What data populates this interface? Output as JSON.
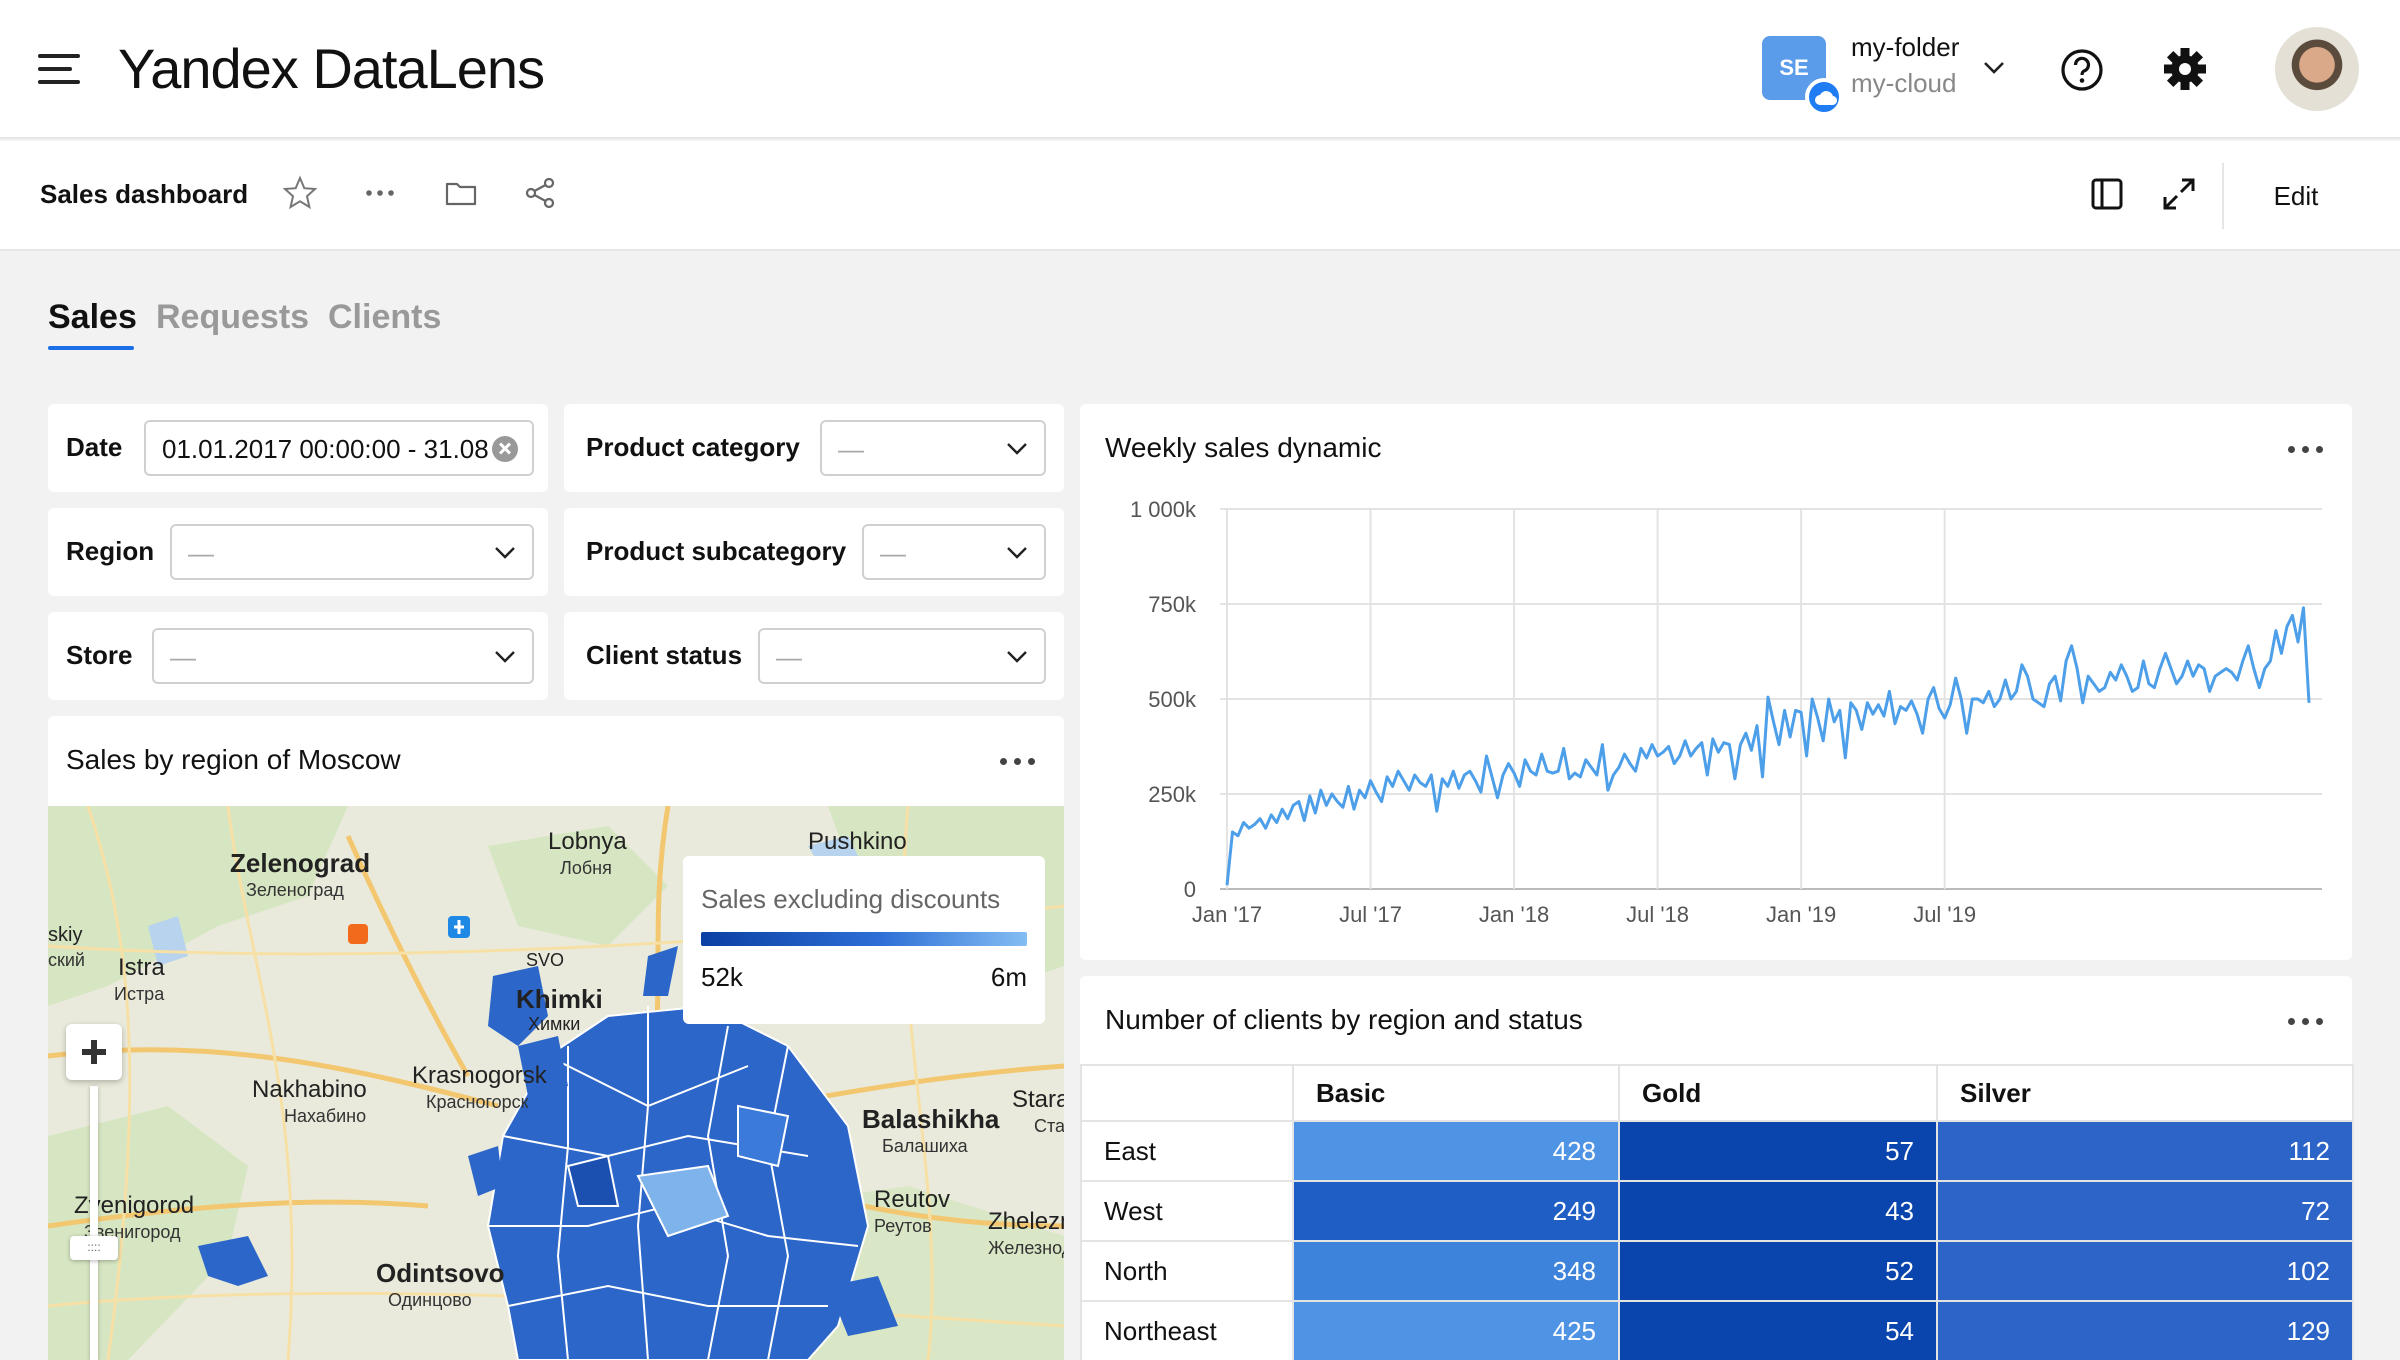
{
  "header": {
    "brand_bold": "Yandex",
    "brand_light": "DataLens",
    "folder_initials": "SE",
    "folder_name": "my-folder",
    "cloud_name": "my-cloud",
    "icons": [
      "menu-icon",
      "chevron-down-icon",
      "help-icon",
      "settings-gear-icon",
      "cloud-icon"
    ]
  },
  "toolbar": {
    "title": "Sales dashboard",
    "edit_label": "Edit",
    "icons": [
      "star-icon",
      "more-icon",
      "folder-icon",
      "share-icon",
      "sidebar-toggle-icon",
      "fullscreen-icon"
    ]
  },
  "tabs": [
    {
      "label": "Sales",
      "active": true
    },
    {
      "label": "Requests",
      "active": false
    },
    {
      "label": "Clients",
      "active": false
    }
  ],
  "selectors": {
    "date": {
      "label": "Date",
      "value": "01.01.2017 00:00:00 - 31.08"
    },
    "product_category": {
      "label": "Product category",
      "value": "—"
    },
    "region": {
      "label": "Region",
      "value": "—"
    },
    "product_subcategory": {
      "label": "Product subcategory",
      "value": "—"
    },
    "store": {
      "label": "Store",
      "value": "—"
    },
    "client_status": {
      "label": "Client status",
      "value": "—"
    }
  },
  "map_widget": {
    "title": "Sales by region of Moscow",
    "legend_title": "Sales excluding discounts",
    "legend_min": "52k",
    "legend_max": "6m",
    "place_labels": [
      {
        "name": "Zelenograd",
        "sub": "Зеленоград"
      },
      {
        "name": "Lobnya",
        "sub": "Лобня"
      },
      {
        "name": "Pushkino",
        "sub": ""
      },
      {
        "name": "Istra",
        "sub": "Истра"
      },
      {
        "name": "Khimki",
        "sub": "Химки"
      },
      {
        "name": "Nakhabino",
        "sub": "Нахабино"
      },
      {
        "name": "Krasnogorsk",
        "sub": "Красногорск"
      },
      {
        "name": "Balashikha",
        "sub": "Балашиха"
      },
      {
        "name": "Reutov",
        "sub": "Реутов"
      },
      {
        "name": "Zvenigorod",
        "sub": "Звенигород"
      },
      {
        "name": "Odintsovo",
        "sub": "Одинцово"
      },
      {
        "name": "Zheleznodorozhny",
        "sub": "Железнодорожный"
      },
      {
        "name": "SVO",
        "sub": ""
      },
      {
        "name": "Stara",
        "sub": "Ста"
      },
      {
        "name": "skiy",
        "sub": "ский"
      }
    ]
  },
  "line_widget": {
    "title": "Weekly sales dynamic"
  },
  "chart_data": {
    "type": "line",
    "title": "Weekly sales dynamic",
    "xlabel": "",
    "ylabel": "",
    "x_tick_labels": [
      "Jan '17",
      "Jul '17",
      "Jan '18",
      "Jul '18",
      "Jan '19",
      "Jul '19"
    ],
    "y_tick_labels": [
      "0",
      "250k",
      "500k",
      "750k",
      "1 000k"
    ],
    "ylim": [
      0,
      1000000
    ],
    "grid": true,
    "color": "#4c9fe8",
    "series": [
      {
        "values": [
          10000,
          150000,
          140000,
          175000,
          160000,
          170000,
          185000,
          160000,
          195000,
          175000,
          210000,
          185000,
          220000,
          230000,
          180000,
          245000,
          200000,
          260000,
          220000,
          250000,
          230000,
          215000,
          270000,
          210000,
          260000,
          240000,
          285000,
          255000,
          230000,
          295000,
          270000,
          310000,
          285000,
          260000,
          300000,
          280000,
          270000,
          300000,
          205000,
          290000,
          270000,
          310000,
          265000,
          300000,
          310000,
          285000,
          255000,
          350000,
          295000,
          240000,
          300000,
          330000,
          305000,
          270000,
          340000,
          310000,
          300000,
          355000,
          310000,
          305000,
          310000,
          370000,
          290000,
          305000,
          295000,
          340000,
          320000,
          300000,
          380000,
          260000,
          300000,
          320000,
          355000,
          330000,
          310000,
          370000,
          345000,
          380000,
          350000,
          360000,
          375000,
          330000,
          350000,
          390000,
          350000,
          370000,
          385000,
          300000,
          395000,
          360000,
          385000,
          380000,
          290000,
          380000,
          410000,
          365000,
          430000,
          295000,
          505000,
          440000,
          380000,
          470000,
          400000,
          470000,
          465000,
          350000,
          500000,
          450000,
          390000,
          500000,
          440000,
          470000,
          345000,
          490000,
          470000,
          420000,
          490000,
          460000,
          485000,
          455000,
          520000,
          435000,
          480000,
          470000,
          495000,
          460000,
          410000,
          500000,
          530000,
          475000,
          450000,
          485000,
          555000,
          500000,
          410000,
          500000,
          500000,
          490000,
          520000,
          480000,
          500000,
          550000,
          500000,
          520000,
          590000,
          560000,
          500000,
          490000,
          480000,
          540000,
          560000,
          495000,
          600000,
          640000,
          580000,
          490000,
          560000,
          540000,
          520000,
          530000,
          570000,
          550000,
          590000,
          560000,
          520000,
          530000,
          600000,
          540000,
          530000,
          580000,
          620000,
          580000,
          540000,
          560000,
          600000,
          560000,
          590000,
          580000,
          520000,
          560000,
          570000,
          580000,
          570000,
          550000,
          600000,
          640000,
          580000,
          530000,
          580000,
          600000,
          680000,
          620000,
          690000,
          720000,
          650000,
          740000,
          490000
        ]
      }
    ]
  },
  "table_widget": {
    "title": "Number of clients by region and status",
    "columns": [
      "",
      "Basic",
      "Gold",
      "Silver"
    ],
    "rows": [
      {
        "label": "East",
        "values": [
          "428",
          "57",
          "112"
        ]
      },
      {
        "label": "West",
        "values": [
          "249",
          "43",
          "72"
        ]
      },
      {
        "label": "North",
        "values": [
          "348",
          "52",
          "102"
        ]
      },
      {
        "label": "Northeast",
        "values": [
          "425",
          "54",
          "129"
        ]
      }
    ],
    "cell_colors": [
      [
        "#4f94e4",
        "#0a45ad",
        "#2d64c8"
      ],
      [
        "#1f5ec4",
        "#0a45ad",
        "#2d64c8"
      ],
      [
        "#3d82db",
        "#0a45ad",
        "#2d64c8"
      ],
      [
        "#4f94e4",
        "#0a45ad",
        "#2d64c8"
      ]
    ]
  }
}
